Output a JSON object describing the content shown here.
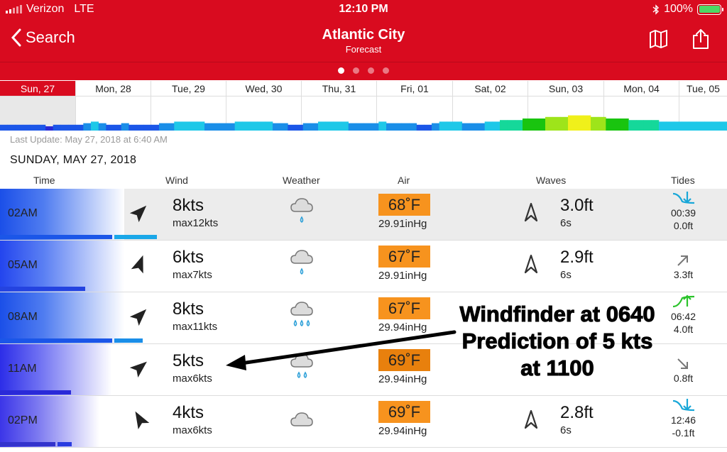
{
  "status": {
    "carrier": "Verizon",
    "network": "LTE",
    "time": "12:10 PM",
    "battery": "100%"
  },
  "nav": {
    "back_label": "Search",
    "title": "Atlantic City",
    "subtitle": "Forecast"
  },
  "days": [
    {
      "label": "Sun, 27",
      "selected": true
    },
    {
      "label": "Mon, 28"
    },
    {
      "label": "Tue, 29"
    },
    {
      "label": "Wed, 30"
    },
    {
      "label": "Thu, 31"
    },
    {
      "label": "Fri, 01"
    },
    {
      "label": "Sat, 02"
    },
    {
      "label": "Sun, 03"
    },
    {
      "label": "Mon, 04"
    },
    {
      "label": "Tue, 05"
    }
  ],
  "last_update": "Last Update: May 27, 2018 at 6:40 AM",
  "date_heading": "SUNDAY, MAY 27, 2018",
  "columns": {
    "time": "Time",
    "wind": "Wind",
    "weather": "Weather",
    "air": "Air",
    "waves": "Waves",
    "tides": "Tides"
  },
  "rows": [
    {
      "time": "02AM",
      "wind": "8kts",
      "max": "max12kts",
      "air": "68˚F",
      "air_color": "#f7931e",
      "pressure": "29.91inHg",
      "wave": "3.0ft",
      "period": "6s",
      "tide_time": "00:39",
      "tide_height": "0.0ft",
      "weather_icon": "light-rain-icon",
      "tide_icon": "tide-low-icon"
    },
    {
      "time": "05AM",
      "wind": "6kts",
      "max": "max7kts",
      "air": "67˚F",
      "air_color": "#f7931e",
      "pressure": "29.91inHg",
      "wave": "2.9ft",
      "period": "6s",
      "tide_height": "3.3ft",
      "weather_icon": "light-rain-icon",
      "tide_icon": "tide-rising-icon"
    },
    {
      "time": "08AM",
      "wind": "8kts",
      "max": "max11kts",
      "air": "67˚F",
      "air_color": "#f7931e",
      "pressure": "29.94inHg",
      "wave": "",
      "period": "",
      "tide_time": "06:42",
      "tide_height": "4.0ft",
      "weather_icon": "heavy-rain-icon",
      "tide_icon": "tide-high-icon"
    },
    {
      "time": "11AM",
      "wind": "5kts",
      "max": "max6kts",
      "air": "69˚F",
      "air_color": "#e87f0c",
      "pressure": "29.94inHg",
      "wave": "",
      "period": "",
      "tide_height": "0.8ft",
      "weather_icon": "rain-icon",
      "tide_icon": "tide-falling-icon"
    },
    {
      "time": "02PM",
      "wind": "4kts",
      "max": "max6kts",
      "air": "69˚F",
      "air_color": "#f7931e",
      "pressure": "29.94inHg",
      "wave": "2.8ft",
      "period": "6s",
      "tide_time": "12:46",
      "tide_height": "-0.1ft",
      "weather_icon": "cloud-icon",
      "tide_icon": "tide-low-icon"
    }
  ],
  "annotation": {
    "line1": "Windfinder at 0640",
    "line2": "Prediction of 5 kts",
    "line3": "at 1100"
  }
}
